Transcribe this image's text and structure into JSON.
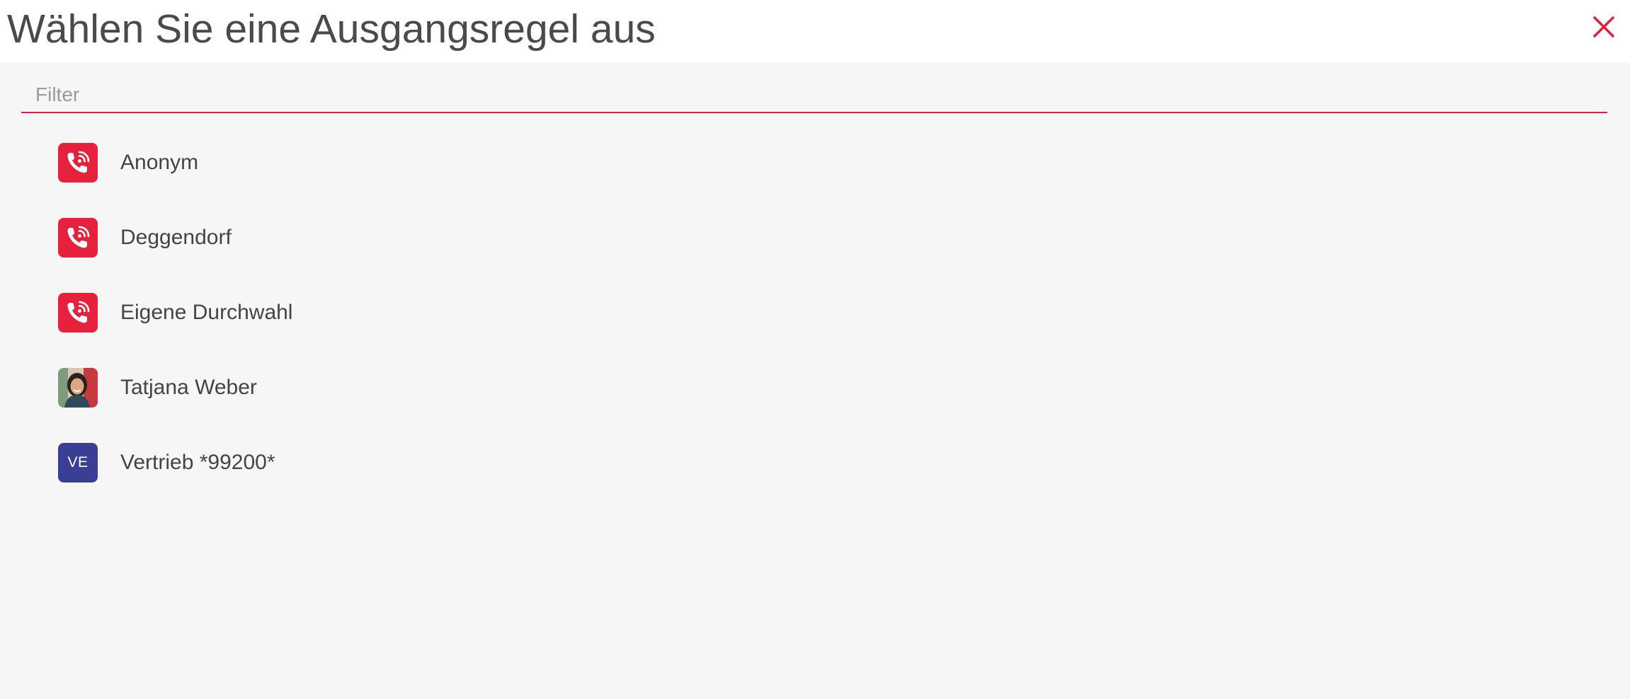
{
  "dialog": {
    "title": "Wählen Sie eine Ausgangsregel aus",
    "close_icon": "close-icon"
  },
  "filter": {
    "placeholder": "Filter",
    "value": ""
  },
  "items": [
    {
      "label": "Anonym",
      "avatar_type": "rule",
      "icon": "phone-ringing-icon"
    },
    {
      "label": "Deggendorf",
      "avatar_type": "rule",
      "icon": "phone-ringing-icon"
    },
    {
      "label": "Eigene Durchwahl",
      "avatar_type": "rule",
      "icon": "phone-ringing-icon"
    },
    {
      "label": "Tatjana Weber",
      "avatar_type": "photo",
      "icon": "user-photo"
    },
    {
      "label": "Vertrieb *99200*",
      "avatar_type": "initials",
      "initials": "VE"
    }
  ],
  "colors": {
    "accent": "#e0203a",
    "rule_icon_bg": "#e5213c",
    "initials_bg": "#3b3f94",
    "background": "#f6f6f6",
    "header_bg": "#ffffff",
    "text": "#444444"
  }
}
